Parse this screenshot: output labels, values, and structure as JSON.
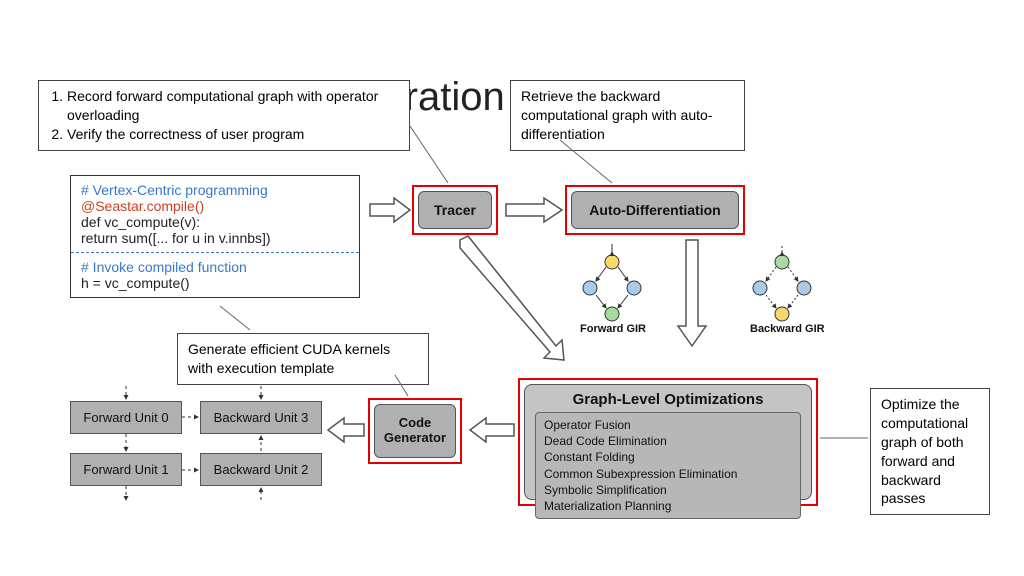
{
  "title": "Seastar: Code Generation",
  "callouts": {
    "topleft": {
      "item1": "Record forward computational graph with operator overloading",
      "item2": "Verify the correctness of user program"
    },
    "topright": "Retrieve the backward computational graph with auto-differentiation",
    "mid": "Generate efficient CUDA kernels with execution template",
    "right": "Optimize the computational graph of both forward and backward passes"
  },
  "code": {
    "comment1": "# Vertex-Centric programming",
    "decorator": "@Seastar.compile()",
    "defline": " def vc_compute(v):",
    "retline": "   return sum([... for u in v.innbs])",
    "comment2": "# Invoke compiled function",
    "call": "h = vc_compute()"
  },
  "stages": {
    "tracer": "Tracer",
    "autodiff": "Auto-Differentiation",
    "codegen": "Code Generator"
  },
  "gir": {
    "forward": "Forward GIR",
    "backward": "Backward GIR"
  },
  "opt": {
    "title": "Graph-Level Optimizations",
    "items": [
      "Operator Fusion",
      "Dead Code Elimination",
      "Constant Folding",
      "Common Subexpression Elimination",
      "Symbolic Simplification",
      "Materialization Planning"
    ]
  },
  "units": {
    "f0": "Forward Unit 0",
    "f1": "Forward Unit 1",
    "b3": "Backward Unit 3",
    "b2": "Backward Unit 2"
  }
}
